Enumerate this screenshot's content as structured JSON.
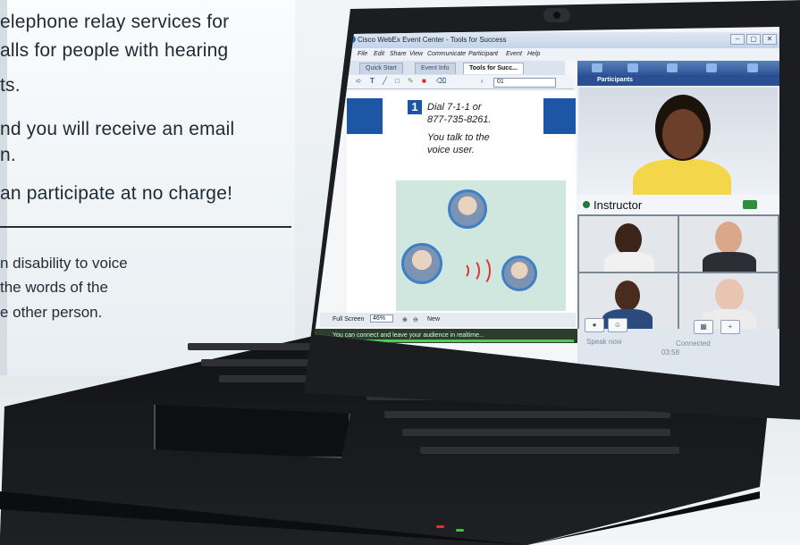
{
  "background": {
    "text_lines": [
      "elephone relay services for",
      "alls for people with hearing",
      "ts.",
      "nd you will receive an email",
      "n.",
      "an participate at no charge!"
    ],
    "small_lines": [
      "n disability to voice",
      "the  words  of  the",
      "e other person."
    ]
  },
  "app": {
    "window_title": "Cisco WebEx Event Center - Tools for Success",
    "menu": [
      "File",
      "Edit",
      "Share",
      "View",
      "Communicate",
      "Participant",
      "Event",
      "Help"
    ],
    "tabs": [
      "Quick Start",
      "Event Info",
      "Tools for Succ..."
    ],
    "page_value": "01",
    "document": {
      "step_number": "1",
      "line1": "Dial 7-1-1 or",
      "line2": "877-735-8261.",
      "line3": "You talk to the",
      "line4": "voice user."
    },
    "doc_controls": {
      "full_screen": "Full Screen",
      "zoom": "46%",
      "new": "New"
    },
    "status_message": "You can connect and leave your audience in realtime...",
    "panel": {
      "participants_label": "Participants",
      "instructor_label": "Instructor",
      "speak_now": "Speak now",
      "connected": "Connected",
      "time": "03:58"
    }
  },
  "colors": {
    "accent_blue": "#1d56a4",
    "panel_header": "#2a4f92",
    "status_green": "#53c95c",
    "laptop_body": "#1c1d20"
  }
}
